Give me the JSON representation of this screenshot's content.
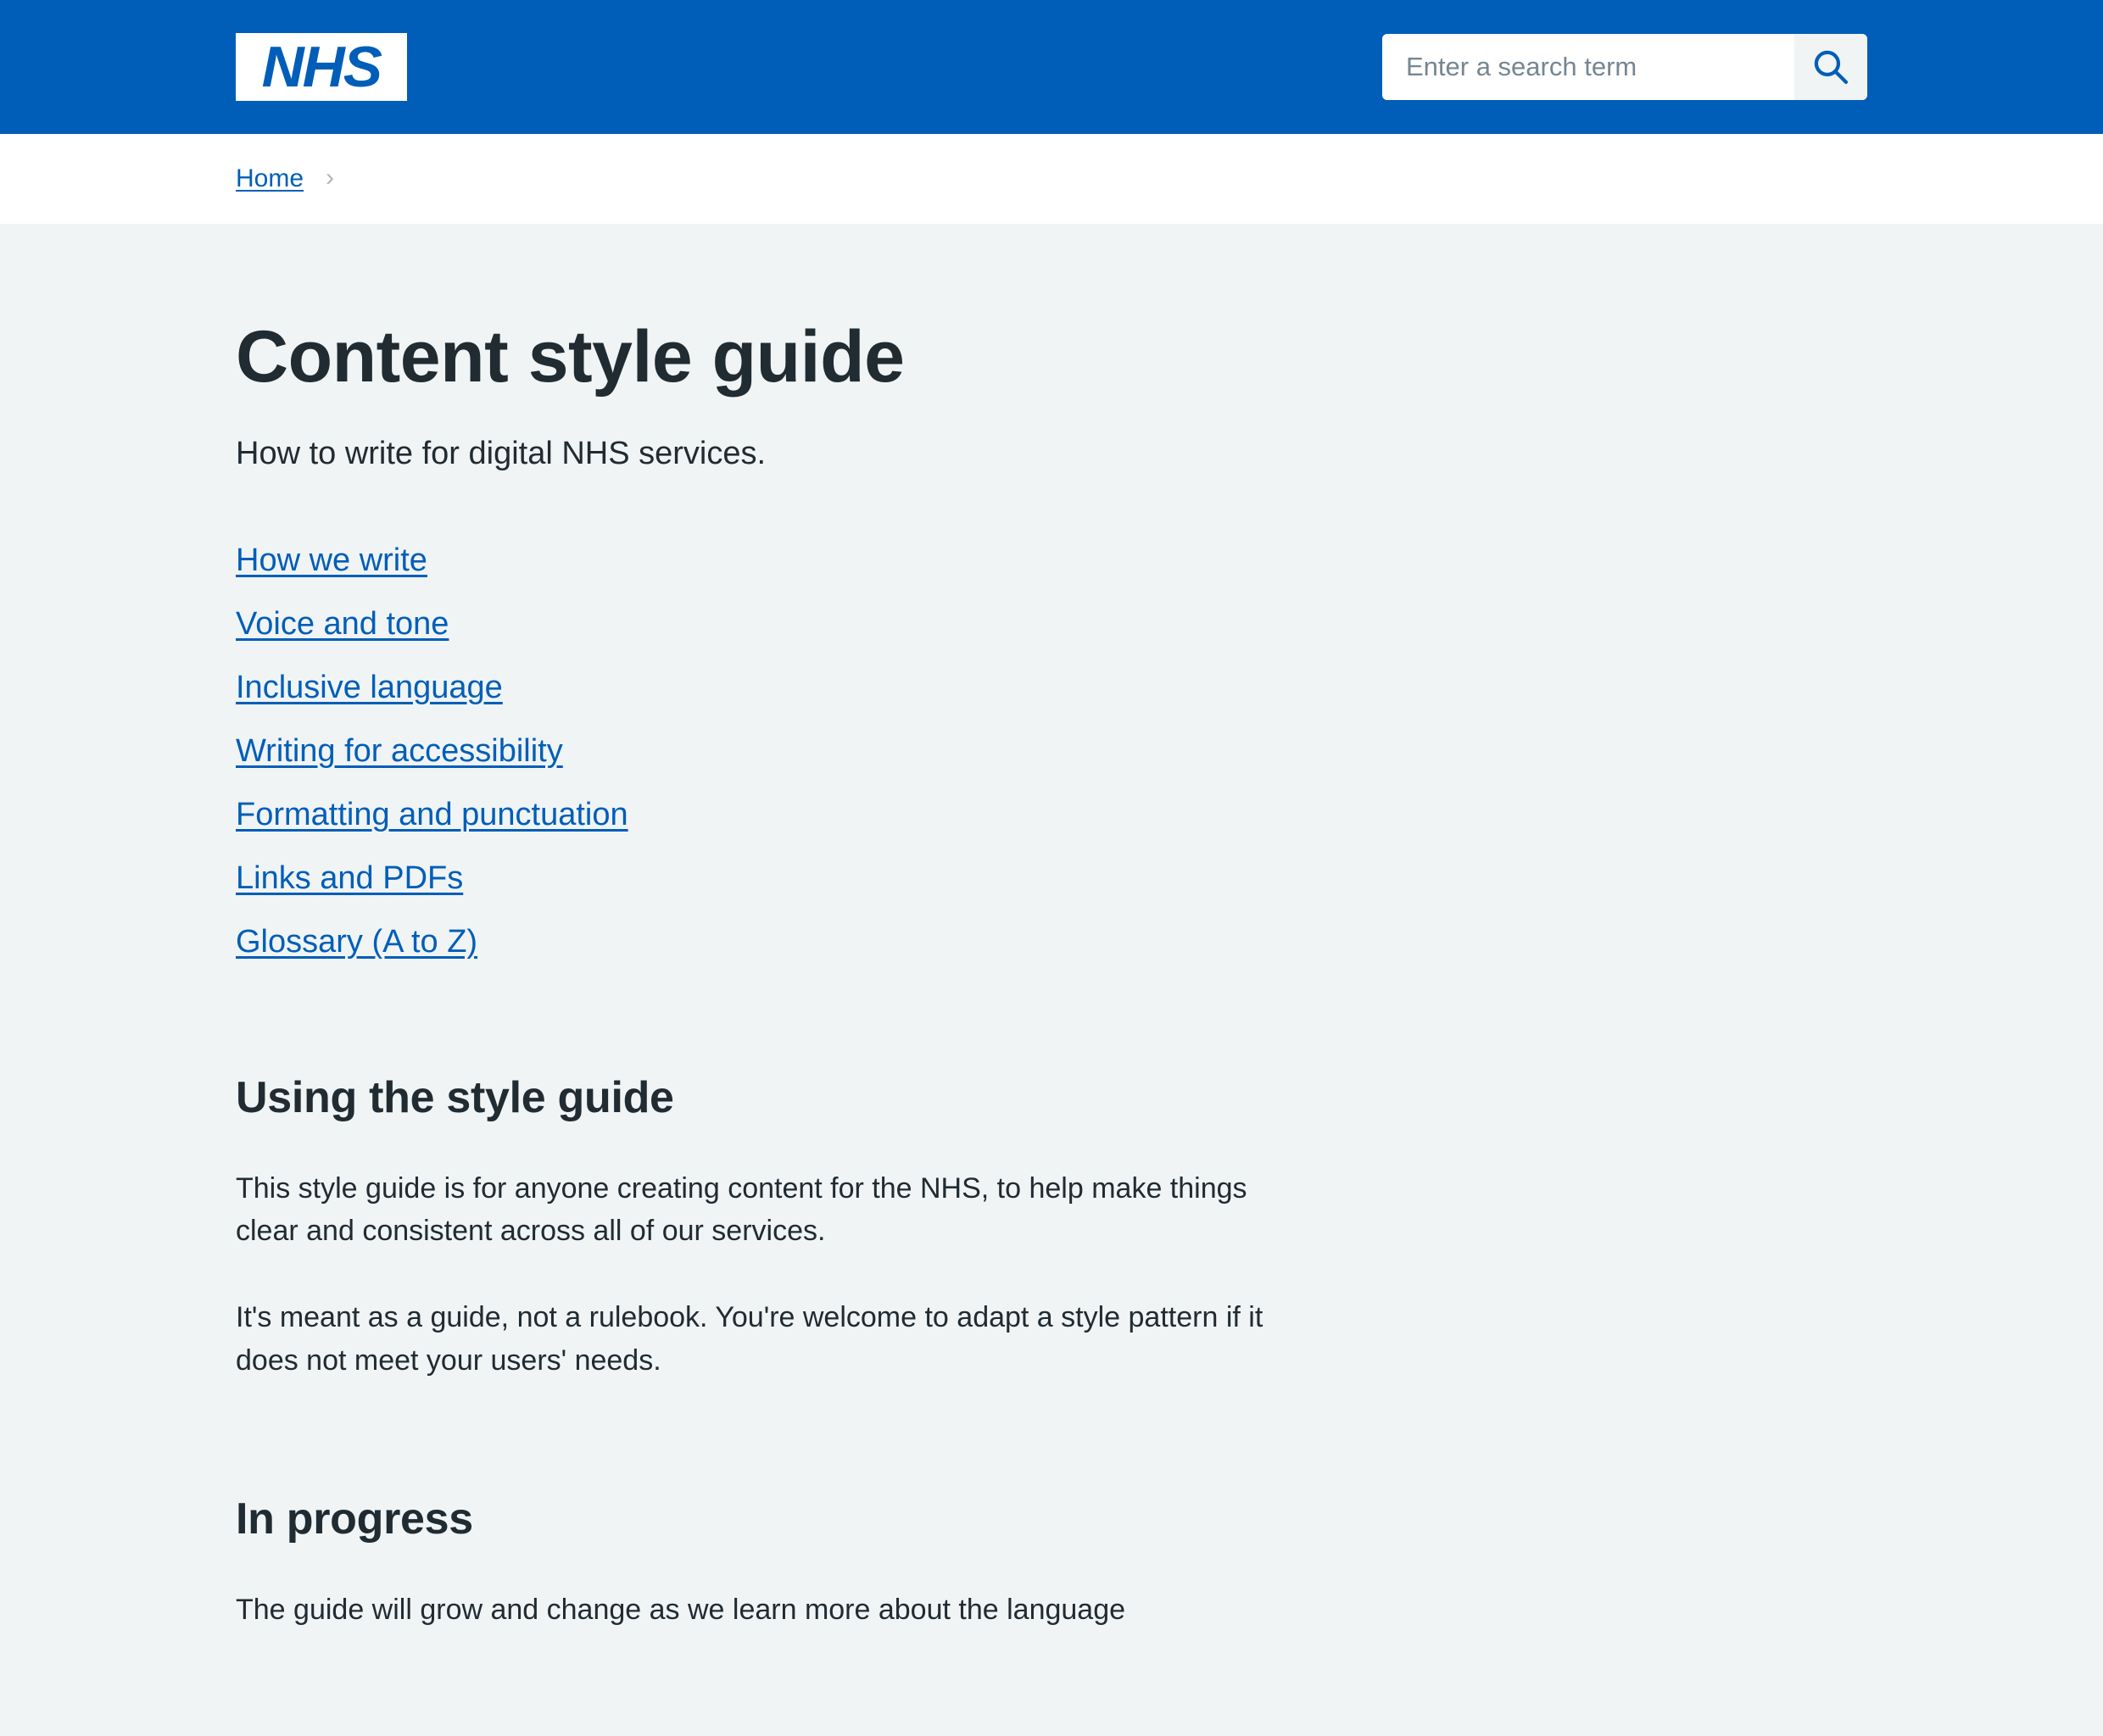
{
  "header": {
    "logo_text": "NHS",
    "logo_alt": "NHS",
    "search": {
      "placeholder": "Enter a search term",
      "value": "",
      "button_icon": "search-icon",
      "button_label": "Search"
    },
    "background_color": "#005eb8"
  },
  "breadcrumb": {
    "items": [
      {
        "label": "Home"
      }
    ],
    "separator": "›"
  },
  "main": {
    "title": "Content style guide",
    "subtitle": "How to write for digital NHS services.",
    "nav_links": [
      {
        "label": "How we write"
      },
      {
        "label": "Voice and tone"
      },
      {
        "label": "Inclusive language"
      },
      {
        "label": "Writing for accessibility"
      },
      {
        "label": "Formatting and punctuation"
      },
      {
        "label": "Links and PDFs"
      },
      {
        "label": "Glossary (A to Z)"
      }
    ],
    "sections": [
      {
        "heading": "Using the style guide",
        "paragraphs": [
          "This style guide is for anyone creating content for the NHS, to help make things clear and consistent across all of our services.",
          "It's meant as a guide, not a rulebook. You're welcome to adapt a style pattern if it does not meet your users' needs."
        ]
      },
      {
        "heading": "In progress",
        "paragraphs": [
          "The guide will grow and change as we learn more about the language"
        ]
      }
    ]
  },
  "colors": {
    "nhs_blue": "#005eb8",
    "page_background": "#f0f4f5",
    "text": "#212b32",
    "link": "#005eb8",
    "placeholder": "#768692",
    "chevron": "#aeb7bd",
    "white": "#ffffff"
  }
}
